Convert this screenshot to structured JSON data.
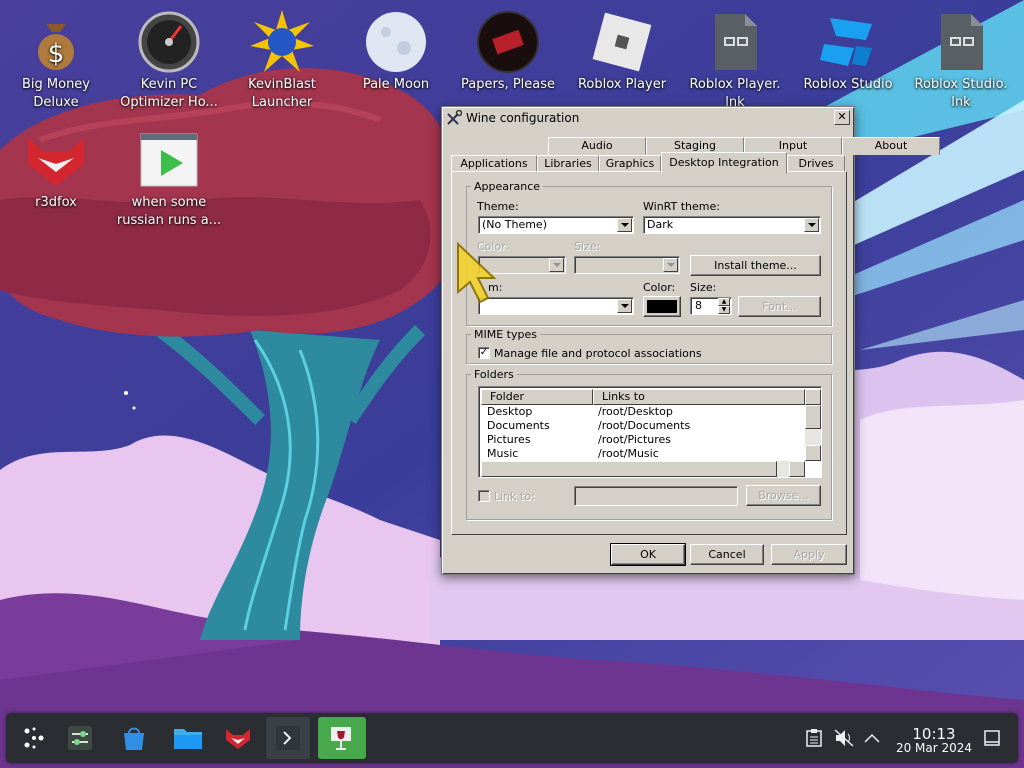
{
  "desktop": {
    "icons": [
      {
        "label": "Big Money Deluxe",
        "icon": "money-bag-icon"
      },
      {
        "label": "Kevin PC Optimizer Ho...",
        "icon": "speed-gauge-icon"
      },
      {
        "label": "KevinBlast Launcher",
        "icon": "blast-star-icon"
      },
      {
        "label": "Pale Moon",
        "icon": "moon-icon"
      },
      {
        "label": "Papers, Please",
        "icon": "papers-please-icon"
      },
      {
        "label": "Roblox Player",
        "icon": "roblox-icon"
      },
      {
        "label": "Roblox Player. lnk",
        "icon": "shortcut-file-icon"
      },
      {
        "label": "Roblox Studio",
        "icon": "roblox-studio-icon"
      },
      {
        "label": "Roblox Studio. lnk",
        "icon": "shortcut-file-icon"
      },
      {
        "label": "r3dfox",
        "icon": "fox-icon"
      },
      {
        "label": "when some russian runs a...",
        "icon": "video-file-icon"
      }
    ]
  },
  "window": {
    "title": "Wine configuration",
    "close": "✕",
    "tabs_row1": [
      "Audio",
      "Staging",
      "Input",
      "About"
    ],
    "tabs_row2": [
      "Applications",
      "Libraries",
      "Graphics",
      "Desktop Integration",
      "Drives"
    ],
    "active_tab": "Desktop Integration",
    "appearance": {
      "legend": "Appearance",
      "theme_label": "Theme:",
      "theme_value": "(No Theme)",
      "winrt_label": "WinRT theme:",
      "winrt_value": "Dark",
      "color_label": "Color:",
      "size_label": "Size:",
      "install_button": "Install theme...",
      "item_label": "m:",
      "item_color_label": "Color:",
      "item_size_label": "Size:",
      "item_size_value": "8",
      "font_button": "Font...",
      "swatch_color": "#000000"
    },
    "mime": {
      "legend": "MIME types",
      "manage_label": "Manage file and protocol associations",
      "manage_checked": "✓"
    },
    "folders": {
      "legend": "Folders",
      "columns": [
        "Folder",
        "Links to"
      ],
      "rows": [
        {
          "folder": "Desktop",
          "link": "/root/Desktop"
        },
        {
          "folder": "Documents",
          "link": "/root/Documents"
        },
        {
          "folder": "Pictures",
          "link": "/root/Pictures"
        },
        {
          "folder": "Music",
          "link": "/root/Music"
        }
      ],
      "link_to_label": "Link to:",
      "browse_button": "Browse..."
    },
    "buttons": {
      "ok": "OK",
      "cancel": "Cancel",
      "apply": "Apply"
    }
  },
  "taskbar": {
    "items": [
      {
        "name": "application-launcher",
        "icon": "launcher-icon",
        "active": false
      },
      {
        "name": "system-settings",
        "icon": "settings-sliders-icon",
        "active": false
      },
      {
        "name": "discover",
        "icon": "store-bag-icon",
        "active": false
      },
      {
        "name": "dolphin",
        "icon": "folder-icon",
        "active": false
      },
      {
        "name": "r3dfox",
        "icon": "fox-icon",
        "active": false
      },
      {
        "name": "terminal",
        "icon": "terminal-icon",
        "active": false
      },
      {
        "name": "wine-configuration",
        "icon": "wine-glass-icon",
        "active": true
      }
    ],
    "time": "10:13",
    "date": "20 Mar 2024",
    "accent": "#3daee9",
    "active_color": "#48a84c"
  }
}
